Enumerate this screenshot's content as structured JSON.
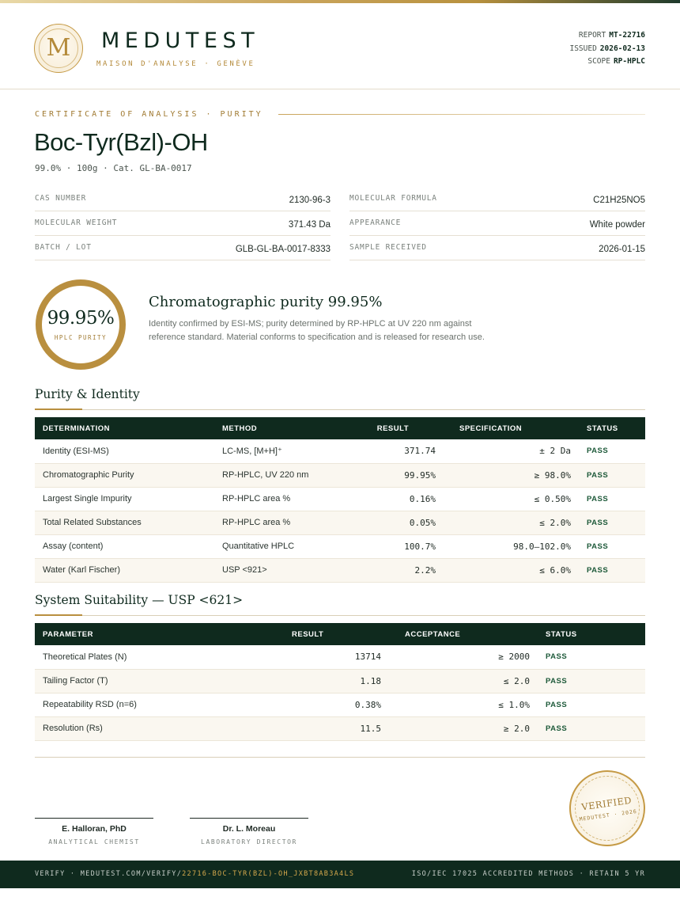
{
  "header": {
    "logo_letter": "M",
    "brand": "MEDUTEST",
    "tagline": "MAISON D'ANALYSE · GENÈVE",
    "meta": [
      {
        "label": "REPORT",
        "value": "MT-22716"
      },
      {
        "label": "ISSUED",
        "value": "2026-02-13"
      },
      {
        "label": "SCOPE",
        "value": "RP-HPLC"
      }
    ]
  },
  "certificate": {
    "eyebrow": "CERTIFICATE OF ANALYSIS · PURITY",
    "product": "Boc-Tyr(Bzl)-OH",
    "subline": "99.0% · 100g  ·  Cat. GL-BA-0017"
  },
  "facts": {
    "left": [
      {
        "label": "CAS NUMBER",
        "value": "2130-96-3"
      },
      {
        "label": "MOLECULAR WEIGHT",
        "value": "371.43 Da"
      },
      {
        "label": "BATCH / LOT",
        "value": "GLB-GL-BA-0017-8333"
      }
    ],
    "right": [
      {
        "label": "MOLECULAR FORMULA",
        "value": "C21H25NO5"
      },
      {
        "label": "APPEARANCE",
        "value": "White powder"
      },
      {
        "label": "SAMPLE RECEIVED",
        "value": "2026-01-15"
      }
    ]
  },
  "purity": {
    "value": "99.95%",
    "label": "HPLC PURITY",
    "title": "Chromatographic purity 99.95%",
    "description": "Identity confirmed by ESI-MS; purity determined by RP-HPLC at UV 220 nm against reference standard. Material conforms to specification and is released for research use."
  },
  "purity_table": {
    "title": "Purity & Identity",
    "headers": [
      "DETERMINATION",
      "METHOD",
      "RESULT",
      "SPECIFICATION",
      "STATUS"
    ],
    "rows": [
      [
        "Identity (ESI-MS)",
        "LC-MS, [M+H]⁺",
        "371.74",
        "± 2 Da",
        "PASS"
      ],
      [
        "Chromatographic Purity",
        "RP-HPLC, UV 220 nm",
        "99.95%",
        "≥ 98.0%",
        "PASS"
      ],
      [
        "Largest Single Impurity",
        "RP-HPLC area %",
        "0.16%",
        "≤ 0.50%",
        "PASS"
      ],
      [
        "Total Related Substances",
        "RP-HPLC area %",
        "0.05%",
        "≤ 2.0%",
        "PASS"
      ],
      [
        "Assay (content)",
        "Quantitative HPLC",
        "100.7%",
        "98.0–102.0%",
        "PASS"
      ],
      [
        "Water (Karl Fischer)",
        "USP <921>",
        "2.2%",
        "≤ 6.0%",
        "PASS"
      ]
    ]
  },
  "suitability_table": {
    "title": "System Suitability — USP <621>",
    "headers": [
      "PARAMETER",
      "RESULT",
      "ACCEPTANCE",
      "STATUS"
    ],
    "rows": [
      [
        "Theoretical Plates (N)",
        "13714",
        "≥ 2000",
        "PASS"
      ],
      [
        "Tailing Factor (T)",
        "1.18",
        "≤ 2.0",
        "PASS"
      ],
      [
        "Repeatability RSD (n=6)",
        "0.38%",
        "≤ 1.0%",
        "PASS"
      ],
      [
        "Resolution (Rs)",
        "11.5",
        "≥ 2.0",
        "PASS"
      ]
    ]
  },
  "signatures": [
    {
      "name": "E. Halloran, PhD",
      "role": "ANALYTICAL CHEMIST"
    },
    {
      "name": "Dr. L. Moreau",
      "role": "LABORATORY DIRECTOR"
    }
  ],
  "seal": {
    "main": "VERIFIED",
    "sub": "MEDUTEST · 2026"
  },
  "footer": {
    "verify_prefix": "VERIFY · MEDUTEST.COM/VERIFY/",
    "verify_code": "22716-BOC-TYR(BZL)-OH_JXBT8AB3A4LS",
    "right": "ISO/IEC 17025 ACCREDITED METHODS · RETAIN 5 YR"
  },
  "colors": {
    "brand_dark": "#0f2a1e",
    "gold": "#b98f3f",
    "pass": "#1e5a3a"
  }
}
